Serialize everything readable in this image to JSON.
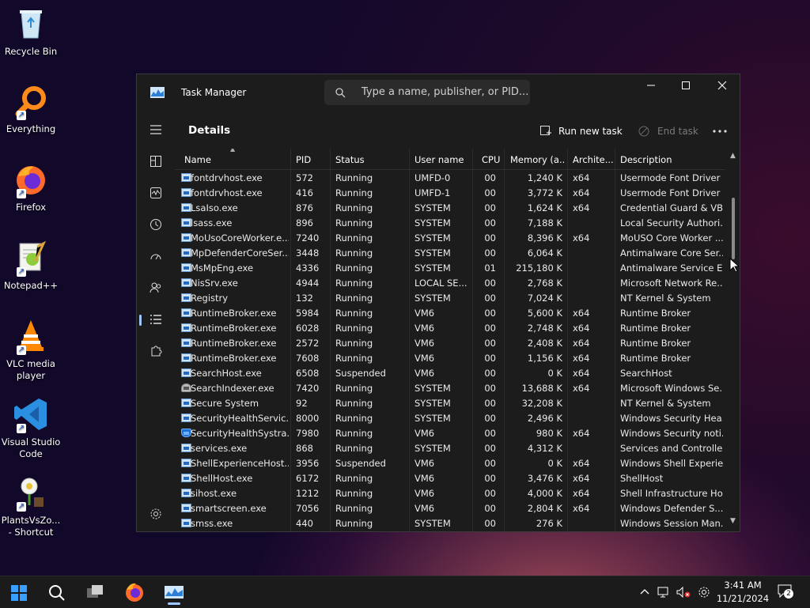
{
  "desktop": {
    "icons": [
      {
        "label": "Recycle Bin",
        "icon": "recycle-bin-icon"
      },
      {
        "label": "Everything",
        "icon": "everything-search-icon"
      },
      {
        "label": "Firefox",
        "icon": "firefox-icon"
      },
      {
        "label": "Notepad++",
        "icon": "notepad-plus-plus-icon"
      },
      {
        "label": "VLC media player",
        "icon": "vlc-icon"
      },
      {
        "label": "Visual Studio Code",
        "icon": "vscode-icon"
      },
      {
        "label": "PlantsVsZo... - Shortcut",
        "icon": "plants-vs-zombies-icon"
      }
    ]
  },
  "window": {
    "title": "Task Manager",
    "search_placeholder": "Type a name, publisher, or PID...",
    "section_title": "Details",
    "run_new_task": "Run new task",
    "end_task": "End task"
  },
  "table": {
    "columns": [
      "Name",
      "PID",
      "Status",
      "User name",
      "CPU",
      "Memory (a...",
      "Archite...",
      "Description"
    ],
    "rows": [
      {
        "name": "fontdrvhost.exe",
        "pid": "572",
        "status": "Running",
        "user": "UMFD-0",
        "cpu": "00",
        "mem": "1,240 K",
        "arch": "x64",
        "desc": "Usermode Font Driver ...",
        "icon": "window"
      },
      {
        "name": "fontdrvhost.exe",
        "pid": "416",
        "status": "Running",
        "user": "UMFD-1",
        "cpu": "00",
        "mem": "3,772 K",
        "arch": "x64",
        "desc": "Usermode Font Driver ...",
        "icon": "window"
      },
      {
        "name": "LsaIso.exe",
        "pid": "876",
        "status": "Running",
        "user": "SYSTEM",
        "cpu": "00",
        "mem": "1,624 K",
        "arch": "x64",
        "desc": "Credential Guard & VB...",
        "icon": "window"
      },
      {
        "name": "lsass.exe",
        "pid": "896",
        "status": "Running",
        "user": "SYSTEM",
        "cpu": "00",
        "mem": "7,188 K",
        "arch": "",
        "desc": "Local Security Authori...",
        "icon": "window"
      },
      {
        "name": "MoUsoCoreWorker.e...",
        "pid": "7240",
        "status": "Running",
        "user": "SYSTEM",
        "cpu": "00",
        "mem": "8,396 K",
        "arch": "x64",
        "desc": "MoUSO Core Worker ...",
        "icon": "window"
      },
      {
        "name": "MpDefenderCoreSer...",
        "pid": "3448",
        "status": "Running",
        "user": "SYSTEM",
        "cpu": "00",
        "mem": "6,064 K",
        "arch": "",
        "desc": "Antimalware Core Ser...",
        "icon": "window"
      },
      {
        "name": "MsMpEng.exe",
        "pid": "4336",
        "status": "Running",
        "user": "SYSTEM",
        "cpu": "01",
        "mem": "215,180 K",
        "arch": "",
        "desc": "Antimalware Service E...",
        "icon": "window"
      },
      {
        "name": "NisSrv.exe",
        "pid": "4944",
        "status": "Running",
        "user": "LOCAL SE...",
        "cpu": "00",
        "mem": "2,768 K",
        "arch": "",
        "desc": "Microsoft Network Re...",
        "icon": "window"
      },
      {
        "name": "Registry",
        "pid": "132",
        "status": "Running",
        "user": "SYSTEM",
        "cpu": "00",
        "mem": "7,024 K",
        "arch": "",
        "desc": "NT Kernel & System",
        "icon": "window"
      },
      {
        "name": "RuntimeBroker.exe",
        "pid": "5984",
        "status": "Running",
        "user": "VM6",
        "cpu": "00",
        "mem": "5,600 K",
        "arch": "x64",
        "desc": "Runtime Broker",
        "icon": "window"
      },
      {
        "name": "RuntimeBroker.exe",
        "pid": "6028",
        "status": "Running",
        "user": "VM6",
        "cpu": "00",
        "mem": "2,748 K",
        "arch": "x64",
        "desc": "Runtime Broker",
        "icon": "window"
      },
      {
        "name": "RuntimeBroker.exe",
        "pid": "2572",
        "status": "Running",
        "user": "VM6",
        "cpu": "00",
        "mem": "2,408 K",
        "arch": "x64",
        "desc": "Runtime Broker",
        "icon": "window"
      },
      {
        "name": "RuntimeBroker.exe",
        "pid": "7608",
        "status": "Running",
        "user": "VM6",
        "cpu": "00",
        "mem": "1,156 K",
        "arch": "x64",
        "desc": "Runtime Broker",
        "icon": "window"
      },
      {
        "name": "SearchHost.exe",
        "pid": "6508",
        "status": "Suspended",
        "user": "VM6",
        "cpu": "00",
        "mem": "0 K",
        "arch": "x64",
        "desc": "SearchHost",
        "icon": "window"
      },
      {
        "name": "SearchIndexer.exe",
        "pid": "7420",
        "status": "Running",
        "user": "SYSTEM",
        "cpu": "00",
        "mem": "13,688 K",
        "arch": "x64",
        "desc": "Microsoft Windows Se...",
        "icon": "person"
      },
      {
        "name": "Secure System",
        "pid": "92",
        "status": "Running",
        "user": "SYSTEM",
        "cpu": "00",
        "mem": "32,208 K",
        "arch": "",
        "desc": "NT Kernel & System",
        "icon": "window"
      },
      {
        "name": "SecurityHealthServic...",
        "pid": "8000",
        "status": "Running",
        "user": "SYSTEM",
        "cpu": "00",
        "mem": "2,496 K",
        "arch": "",
        "desc": "Windows Security Hea...",
        "icon": "window"
      },
      {
        "name": "SecurityHealthSystra...",
        "pid": "7980",
        "status": "Running",
        "user": "VM6",
        "cpu": "00",
        "mem": "980 K",
        "arch": "x64",
        "desc": "Windows Security noti...",
        "icon": "shield"
      },
      {
        "name": "services.exe",
        "pid": "868",
        "status": "Running",
        "user": "SYSTEM",
        "cpu": "00",
        "mem": "4,312 K",
        "arch": "",
        "desc": "Services and Controlle...",
        "icon": "window"
      },
      {
        "name": "ShellExperienceHost....",
        "pid": "3956",
        "status": "Suspended",
        "user": "VM6",
        "cpu": "00",
        "mem": "0 K",
        "arch": "x64",
        "desc": "Windows Shell Experie...",
        "icon": "window"
      },
      {
        "name": "ShellHost.exe",
        "pid": "6172",
        "status": "Running",
        "user": "VM6",
        "cpu": "00",
        "mem": "3,476 K",
        "arch": "x64",
        "desc": "ShellHost",
        "icon": "window"
      },
      {
        "name": "sihost.exe",
        "pid": "1212",
        "status": "Running",
        "user": "VM6",
        "cpu": "00",
        "mem": "4,000 K",
        "arch": "x64",
        "desc": "Shell Infrastructure Host",
        "icon": "window"
      },
      {
        "name": "smartscreen.exe",
        "pid": "7056",
        "status": "Running",
        "user": "VM6",
        "cpu": "00",
        "mem": "2,804 K",
        "arch": "x64",
        "desc": "Windows Defender S...",
        "icon": "window"
      },
      {
        "name": "smss.exe",
        "pid": "440",
        "status": "Running",
        "user": "SYSTEM",
        "cpu": "00",
        "mem": "276 K",
        "arch": "",
        "desc": "Windows Session Man...",
        "icon": "window"
      }
    ]
  },
  "taskbar": {
    "time": "3:41 AM",
    "date": "11/21/2024",
    "notification_count": "2"
  }
}
